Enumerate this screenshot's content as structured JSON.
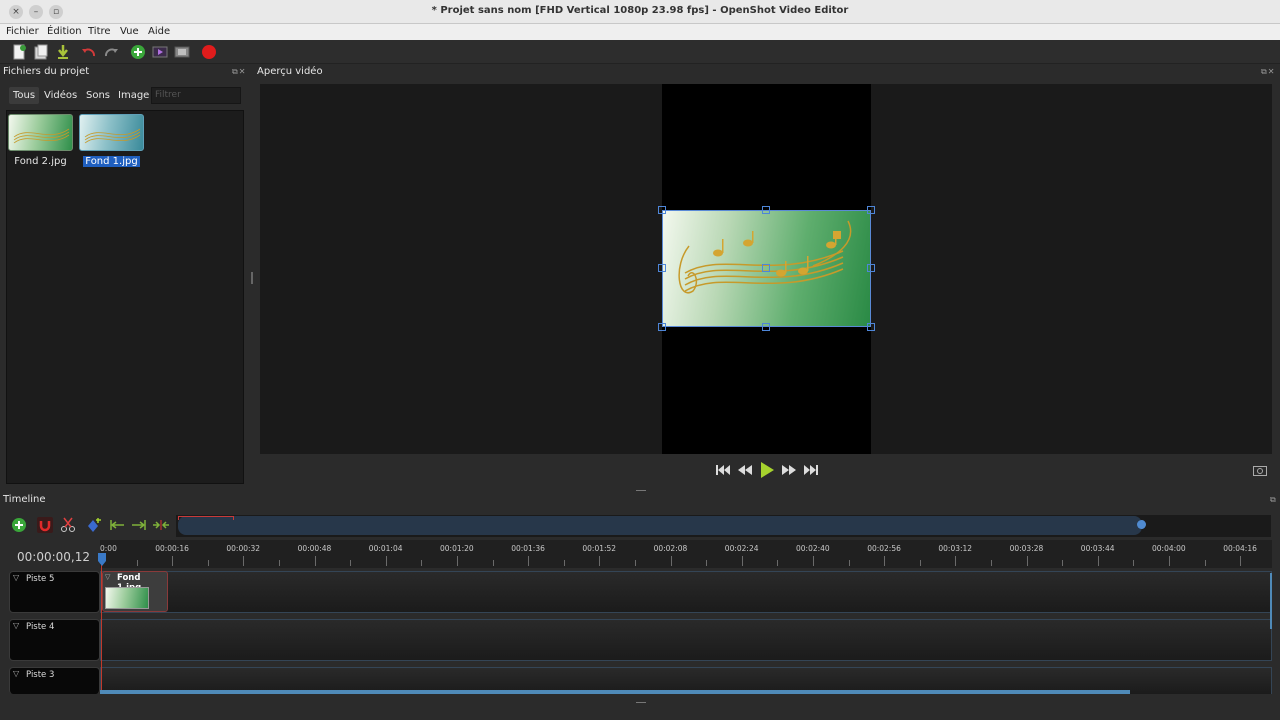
{
  "window": {
    "title": "* Projet sans nom [FHD Vertical 1080p 23.98 fps] - OpenShot Video Editor",
    "close_glyph": "×",
    "minimize_glyph": "–",
    "maximize_glyph": "▫"
  },
  "menubar": [
    "Fichier",
    "Édition",
    "Titre",
    "Vue",
    "Aide"
  ],
  "toolbar": {
    "icons": [
      "new-project-icon",
      "open-project-icon",
      "save-project-icon",
      "undo-icon",
      "redo-icon",
      "import-files-icon",
      "profile-icon",
      "fullscreen-icon",
      "export-video-icon"
    ]
  },
  "project_files": {
    "title": "Fichiers du projet",
    "tabs": [
      "Tous",
      "Vidéos",
      "Sons",
      "Image"
    ],
    "active_tab": "Tous",
    "filter_placeholder": "Filtrer",
    "files": [
      {
        "name": "Fond 2.jpg",
        "selected": false
      },
      {
        "name": "Fond 1.jpg",
        "selected": true
      }
    ]
  },
  "preview": {
    "title": "Aperçu vidéo",
    "controls": [
      "jump-start-icon",
      "rewind-icon",
      "play-icon",
      "fast-forward-icon",
      "jump-end-icon"
    ]
  },
  "timeline": {
    "title": "Timeline",
    "current_time": "00:00:00,12",
    "ruler_labels": [
      "0:00",
      "00:00:16",
      "00:00:32",
      "00:00:48",
      "00:01:04",
      "00:01:20",
      "00:01:36",
      "00:01:52",
      "00:02:08",
      "00:02:24",
      "00:02:40",
      "00:02:56",
      "00:03:12",
      "00:03:28",
      "00:03:44",
      "00:04:00",
      "00:04:16"
    ],
    "tracks": [
      {
        "name": "Piste 5",
        "clips": [
          {
            "name": "Fond 1.jpg"
          }
        ]
      },
      {
        "name": "Piste 4",
        "clips": []
      },
      {
        "name": "Piste 3",
        "clips": []
      }
    ]
  },
  "colors": {
    "accent": "#4e86d8",
    "playhead": "#c0392b",
    "selection": "#1f5fbf"
  }
}
